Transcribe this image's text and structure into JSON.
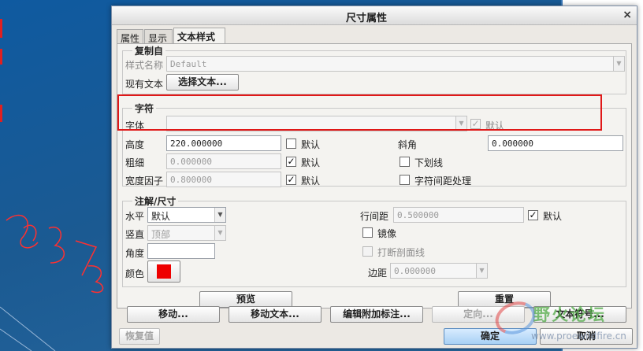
{
  "dialog": {
    "title": "尺寸属性",
    "close_glyph": "×"
  },
  "tabs": [
    {
      "label": "属性"
    },
    {
      "label": "显示"
    },
    {
      "label": "文本样式"
    }
  ],
  "copy_from": {
    "legend": "复制自",
    "style_name_label": "样式名称",
    "style_name_value": "Default",
    "existing_text_label": "现有文本",
    "select_text_button": "选择文本..."
  },
  "character": {
    "legend": "字符",
    "font_label": "字体",
    "font_value": "",
    "font_default_label": "默认",
    "height_label": "高度",
    "height_value": "220.000000",
    "height_default_label": "默认",
    "slant_label": "斜角",
    "slant_value": "0.000000",
    "thickness_label": "粗细",
    "thickness_value": "0.000000",
    "thickness_default_label": "默认",
    "underline_label": "下划线",
    "width_factor_label": "宽度因子",
    "width_factor_value": "0.800000",
    "width_factor_default_label": "默认",
    "kerning_label": "字符间距处理"
  },
  "note_dim": {
    "legend": "注解/尺寸",
    "horizontal_label": "水平",
    "horizontal_value": "默认",
    "vertical_label": "竖直",
    "vertical_value": "顶部",
    "angle_label": "角度",
    "angle_value": "",
    "color_label": "颜色",
    "color_hex": "#ee0000",
    "line_spacing_label": "行间距",
    "line_spacing_value": "0.500000",
    "line_spacing_default_label": "默认",
    "mirror_label": "镜像",
    "break_hatch_label": "打断剖面线",
    "margin_label": "边距",
    "margin_value": "0.000000"
  },
  "buttons": {
    "preview": "预览",
    "reset": "重置",
    "move": "移动...",
    "move_text": "移动文本...",
    "edit_attach": "编辑附加标注...",
    "orient": "定向...",
    "text_symbol": "文本符号...",
    "restore": "恢复值",
    "ok": "确定",
    "cancel": "取消"
  },
  "watermark": {
    "title": "野火论坛",
    "url": "www.proewildfire.cn"
  }
}
